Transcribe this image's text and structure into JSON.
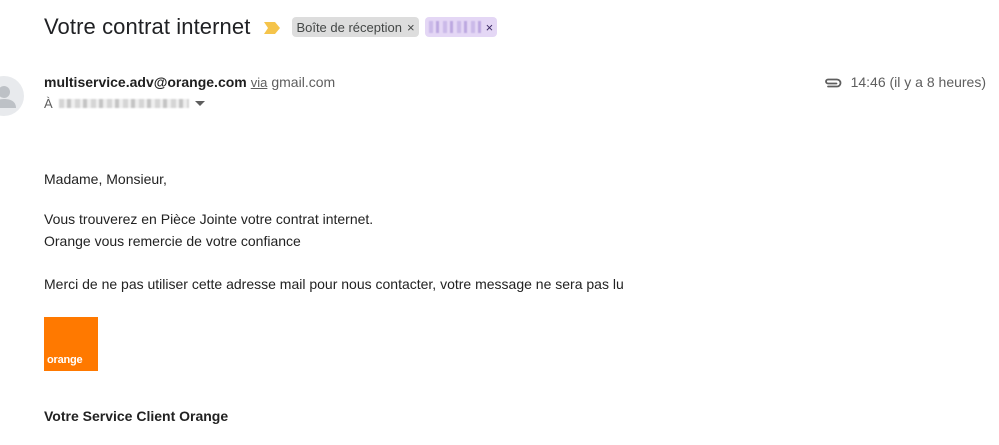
{
  "email": {
    "subject": "Votre contrat internet",
    "labels": [
      {
        "name": "Boîte de réception",
        "close": "×"
      },
      {
        "name": "",
        "close": "×"
      }
    ],
    "sender": {
      "email": "multiservice.adv@orange.com",
      "via_label": "via",
      "via_domain": "gmail.com"
    },
    "recipient_prefix": "À",
    "time": "14:46 (il y a 8 heures)",
    "body": [
      "Madame, Monsieur,",
      "Vous trouverez en Pièce Jointe votre contrat internet.",
      "Orange vous remercie de votre confiance",
      "Merci de ne pas utiliser cette adresse mail pour nous contacter, votre message ne sera pas lu"
    ],
    "logo_text": "orange",
    "signature": "Votre Service Client Orange"
  },
  "colors": {
    "brand_orange": "#ff7900",
    "importance_marker": "#f5c44b",
    "inbox_chip": "#dddddd",
    "custom_chip": "#e4d7f5"
  },
  "icons": [
    "importance-marker-icon",
    "close-icon",
    "avatar-person-icon",
    "caret-down-icon",
    "attachment-icon"
  ]
}
